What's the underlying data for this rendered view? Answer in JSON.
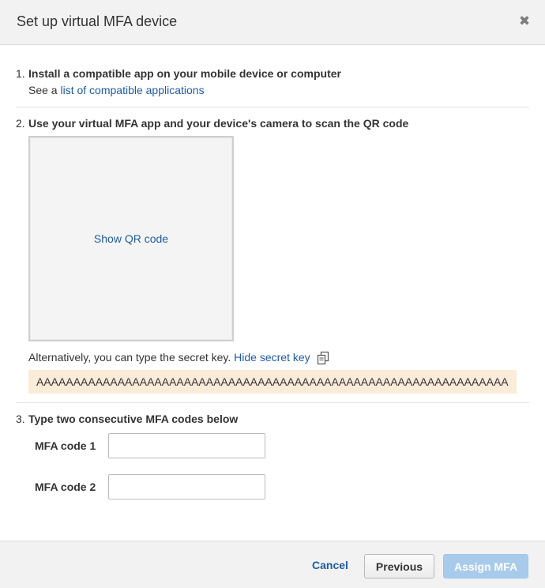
{
  "dialog": {
    "title": "Set up virtual MFA device",
    "close_symbol": "✖"
  },
  "step1": {
    "number": "1.",
    "title": "Install a compatible app on your mobile device or computer",
    "see_prefix": "See a ",
    "link_text": "list of compatible applications"
  },
  "step2": {
    "number": "2.",
    "title": "Use your virtual MFA app and your device's camera to scan the QR code",
    "qr_link": "Show QR code",
    "alt_text": "Alternatively, you can type the secret key.",
    "hide_link": "Hide secret key",
    "copy_icon": "copy-icon",
    "secret_key": "AAAAAAAAAAAAAAAAAAAAAAAAAAAAAAAAAAAAAAAAAAAAAAAAAAAAAAAAAAAAAAAA"
  },
  "step3": {
    "number": "3.",
    "title": "Type two consecutive MFA codes below",
    "code1_label": "MFA code 1",
    "code1_value": "",
    "code2_label": "MFA code 2",
    "code2_value": ""
  },
  "footer": {
    "cancel_label": "Cancel",
    "previous_label": "Previous",
    "assign_label": "Assign MFA"
  },
  "colors": {
    "link": "#1f5ba3",
    "secret_bg": "#fbebd9",
    "assign_disabled": "#a9cbeb",
    "header_bg": "#f2f2f2"
  }
}
